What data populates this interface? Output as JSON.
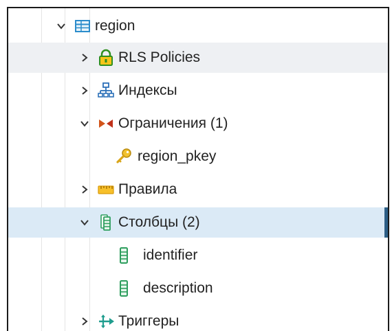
{
  "tree": {
    "items": [
      {
        "label": "region",
        "icon": "table-icon",
        "expanded": true
      },
      {
        "label": "RLS Policies",
        "icon": "lock-icon",
        "expanded": false
      },
      {
        "label": "Индексы",
        "icon": "index-icon",
        "expanded": false
      },
      {
        "label": "Ограничения (1)",
        "icon": "constraint-icon",
        "expanded": true
      },
      {
        "label": "region_pkey",
        "icon": "key-icon"
      },
      {
        "label": "Правила",
        "icon": "rule-icon",
        "expanded": false
      },
      {
        "label": "Столбцы (2)",
        "icon": "columns-icon",
        "expanded": true
      },
      {
        "label": "identifier",
        "icon": "column-icon"
      },
      {
        "label": "description",
        "icon": "column-icon"
      },
      {
        "label": "Триггеры",
        "icon": "trigger-icon",
        "expanded": false
      }
    ]
  },
  "colors": {
    "selected_bg": "#dbeaf6",
    "hover_bg": "#eef0f3",
    "selected_bar": "#2d5f86"
  }
}
